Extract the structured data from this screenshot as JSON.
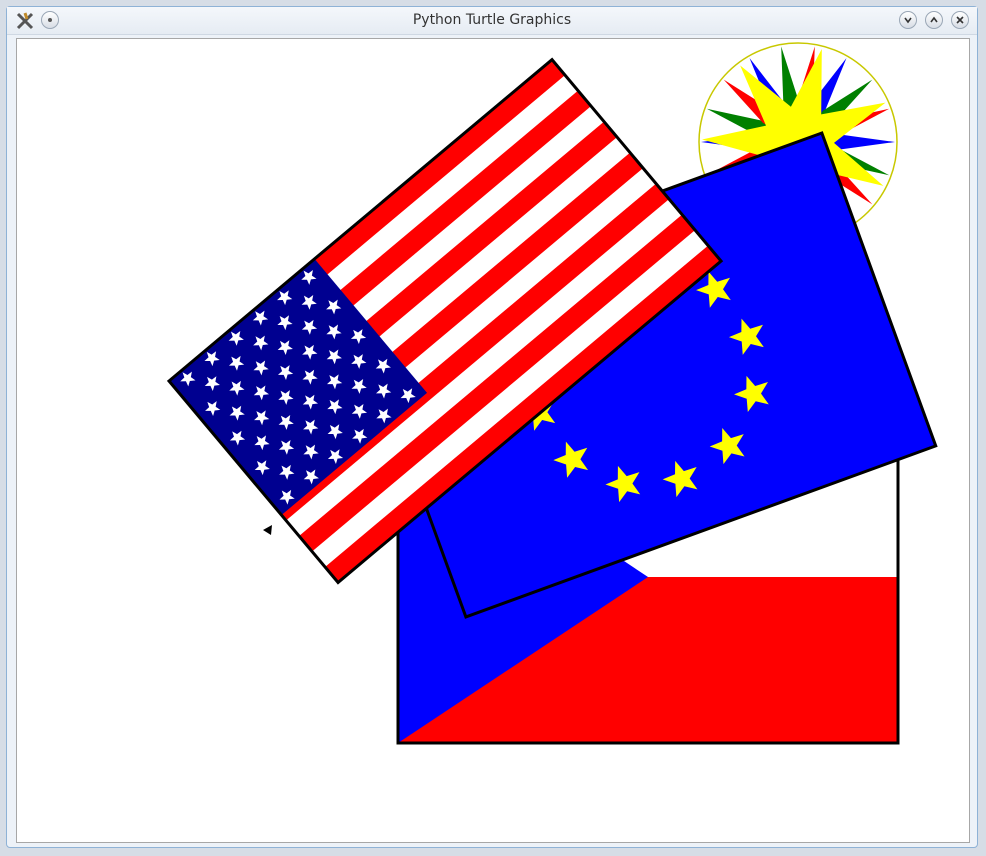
{
  "window": {
    "title": "Python Turtle Graphics"
  },
  "colors": {
    "us_red": "#ff0000",
    "us_blue": "#000090",
    "eu_blue": "#0000ff",
    "eu_star": "#ffff00",
    "compass_green": "#008000"
  },
  "icons": [
    "app-icon",
    "pin-icon",
    "minimize-icon",
    "maximize-icon",
    "close-icon",
    "turtle-cursor-icon"
  ]
}
